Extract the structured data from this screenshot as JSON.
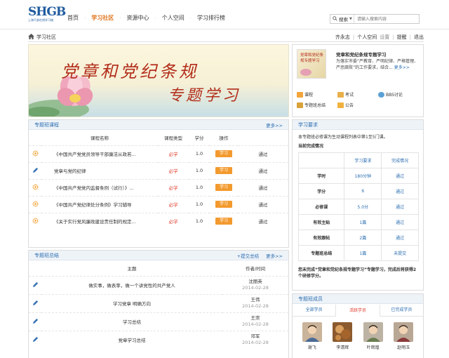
{
  "brand": {
    "logo_text": "SHGB",
    "logo_subtitle": "上海干部在线学习城"
  },
  "nav": {
    "items": [
      {
        "label": "首页",
        "active": false
      },
      {
        "label": "学习社区",
        "active": true
      },
      {
        "label": "资源中心",
        "active": false
      },
      {
        "label": "个人空间",
        "active": false
      },
      {
        "label": "学习排行榜",
        "active": false
      }
    ]
  },
  "search": {
    "scope": "搜索",
    "placeholder": "请输入搜索内容"
  },
  "breadcrumb": {
    "label": "学习社区"
  },
  "userbar": {
    "user": "齐永志",
    "space": "个人空间",
    "settings": "设置",
    "reminder": "提醒",
    "logout": "退出"
  },
  "banner": {
    "line1": "党章和党纪条规",
    "line2": "专题学习"
  },
  "info": {
    "thumb_text": "党章和党纪条规专题学习",
    "title": "党章和党纪条规专题学习",
    "desc": "为落实市委“严教育、严明纪律、严格管理、严惩腐败”的工作要求，结合...",
    "more": "更多>>",
    "links": [
      {
        "label": "课程",
        "icon": "course-icon",
        "color": "#f3a43a"
      },
      {
        "label": "考试",
        "icon": "exam-icon",
        "color": "#e8b04a"
      },
      {
        "label": "BBS讨论",
        "icon": "bbs-icon",
        "color": "#5aa0d6"
      },
      {
        "label": "专题班总结",
        "icon": "summary-icon",
        "color": "#d9a23a"
      },
      {
        "label": "公告",
        "icon": "notice-icon",
        "color": "#f0b23f"
      }
    ]
  },
  "courses": {
    "title": "专题班课程",
    "more": "更多>>",
    "headers": [
      "课程名称",
      "课程类型",
      "学分",
      "操作"
    ],
    "rows": [
      {
        "icon": "gear-icon",
        "name": "《中国共产党党员领导干部廉洁从政若...",
        "type": "必学",
        "credit": "1.0",
        "action": "学习",
        "status": "通过"
      },
      {
        "icon": "pencil-icon",
        "name": "党章与党的纪律",
        "type": "必学",
        "credit": "1.0",
        "action": "学习",
        "status": "通过"
      },
      {
        "icon": "gear-icon",
        "name": "《中国共产党党内监督条例（试行）》...",
        "type": "必学",
        "credit": "1.0",
        "action": "学习",
        "status": "通过"
      },
      {
        "icon": "gear-icon",
        "name": "《中国共产党纪律处分条例》学习辅导",
        "type": "必学",
        "credit": "1.0",
        "action": "学习",
        "status": "通过"
      },
      {
        "icon": "gear-icon",
        "name": "《关于实行党风廉政建设责任制的规定...",
        "type": "必学",
        "credit": "1.0",
        "action": "学习",
        "status": "通过"
      }
    ]
  },
  "summaries": {
    "title": "专题班总结",
    "submit": "+提交总结",
    "more": "更多>>",
    "headers": [
      "主题",
      "作者/时间"
    ],
    "rows": [
      {
        "title": "做实事，做表率，做一个讲党性的共产党人",
        "author": "沈丽英",
        "date": "2014-02-28"
      },
      {
        "title": "学习党章 明确方向",
        "author": "王伟",
        "date": "2014-02-28"
      },
      {
        "title": "学习总结",
        "author": "王崇",
        "date": "2014-02-28"
      },
      {
        "title": "党章学习总结",
        "author": "邓军",
        "date": "2014-02-28"
      }
    ]
  },
  "requirements": {
    "title": "学习要求",
    "text": "本专题班必修课为生动课程列表中第1至5门课。",
    "progress_title": "当前完成情况",
    "col_required": "学习要求",
    "col_done": "完成情况",
    "rows": [
      {
        "label": "学时",
        "required": "180分钟",
        "done": "通过"
      },
      {
        "label": "学分",
        "required": "6",
        "done": "通过"
      },
      {
        "label": "必修课",
        "required": "5.0分",
        "done": "通过"
      },
      {
        "label": "有效主贴",
        "required": "1篇",
        "done": "通过"
      },
      {
        "label": "有效跟帖",
        "required": "2篇",
        "done": "通过"
      },
      {
        "label": "专题班总结",
        "required": "1篇",
        "done": "未提交"
      }
    ],
    "footer": "您未完成“党章和党纪条规专题学习”专题学习，完成后将获得2个研修学分。"
  },
  "members": {
    "title": "专题班成员",
    "tabs": [
      {
        "label": "全部学员",
        "active": false
      },
      {
        "label": "活跃学员",
        "active": true
      },
      {
        "label": "已完成学员",
        "active": false
      }
    ],
    "list": [
      {
        "name": "谢飞",
        "color": "#c9b39a"
      },
      {
        "name": "李清辉",
        "color": "#8a5a2e"
      },
      {
        "name": "叶辉煌",
        "color": "#bdb3a4"
      },
      {
        "name": "赵明玉",
        "color": "#b9a795"
      }
    ]
  }
}
